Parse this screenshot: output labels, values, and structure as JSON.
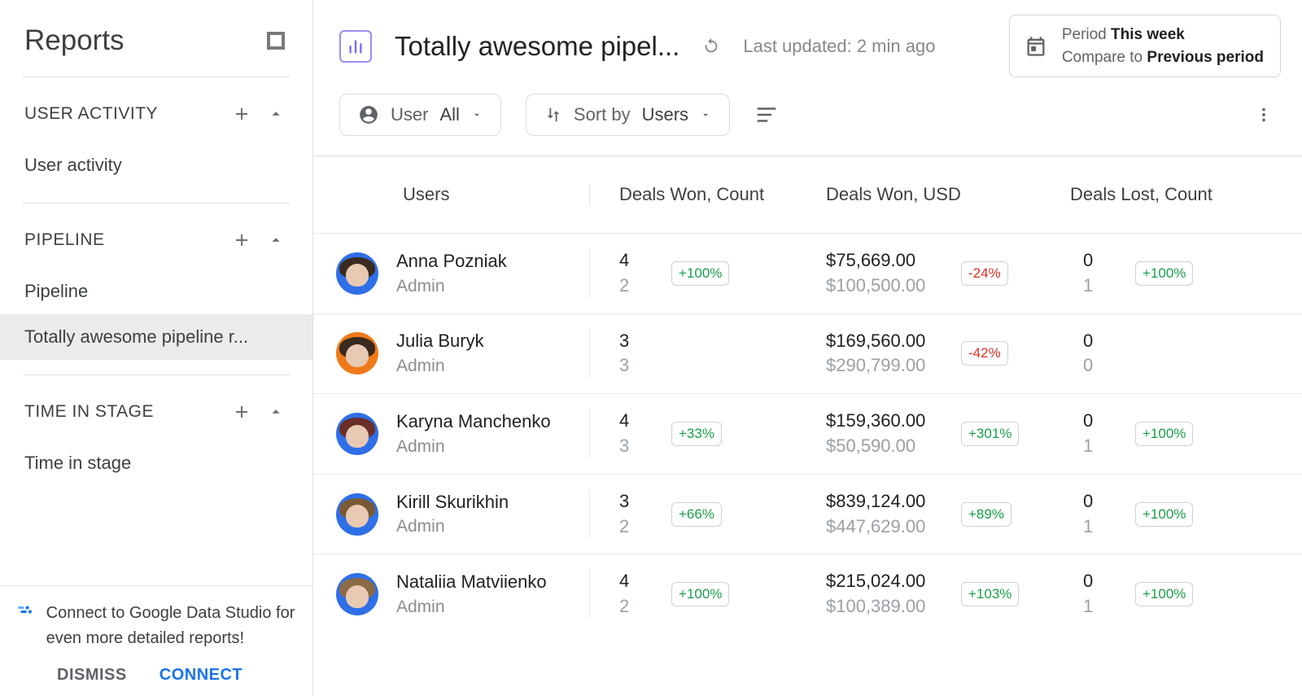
{
  "sidebar": {
    "title": "Reports",
    "sections": [
      {
        "title": "USER ACTIVITY",
        "items": [
          "User activity"
        ]
      },
      {
        "title": "PIPELINE",
        "items": [
          "Pipeline",
          "Totally awesome pipeline r..."
        ],
        "activeIndex": 1
      },
      {
        "title": "TIME IN STAGE",
        "items": [
          "Time in stage"
        ]
      }
    ],
    "promo": {
      "text": "Connect to Google Data Studio for even more detailed reports!",
      "dismiss": "DISMISS",
      "connect": "CONNECT"
    }
  },
  "header": {
    "report_title": "Totally awesome pipel...",
    "last_updated_prefix": "Last updated:",
    "last_updated_value": "2 min ago",
    "period_label": "Period",
    "period_value": "This week",
    "compare_label": "Compare to",
    "compare_value": "Previous period"
  },
  "filters": {
    "user_label": "User",
    "user_value": "All",
    "sort_label": "Sort by",
    "sort_value": "Users"
  },
  "columns": [
    "Users",
    "Deals Won, Count",
    "Deals Won, USD",
    "Deals Lost, Count"
  ],
  "rows": [
    {
      "name": "Anna Pozniak",
      "role": "Admin",
      "avatar_bg": "#2f6fe8",
      "hair": "#3a2a1f",
      "won_count": {
        "cur": "4",
        "prev": "2",
        "delta": "+100%",
        "dir": "pos"
      },
      "won_usd": {
        "cur": "$75,669.00",
        "prev": "$100,500.00",
        "delta": "-24%",
        "dir": "neg"
      },
      "lost_count": {
        "cur": "0",
        "prev": "1",
        "delta": "+100%",
        "dir": "pos"
      }
    },
    {
      "name": "Julia Buryk",
      "role": "Admin",
      "avatar_bg": "#f07a1a",
      "hair": "#3a2a1f",
      "won_count": {
        "cur": "3",
        "prev": "3",
        "delta": "",
        "dir": ""
      },
      "won_usd": {
        "cur": "$169,560.00",
        "prev": "$290,799.00",
        "delta": "-42%",
        "dir": "neg"
      },
      "lost_count": {
        "cur": "0",
        "prev": "0",
        "delta": "",
        "dir": ""
      }
    },
    {
      "name": "Karyna Manchenko",
      "role": "Admin",
      "avatar_bg": "#2f6fe8",
      "hair": "#6b2f2a",
      "won_count": {
        "cur": "4",
        "prev": "3",
        "delta": "+33%",
        "dir": "pos"
      },
      "won_usd": {
        "cur": "$159,360.00",
        "prev": "$50,590.00",
        "delta": "+301%",
        "dir": "pos"
      },
      "lost_count": {
        "cur": "0",
        "prev": "1",
        "delta": "+100%",
        "dir": "pos"
      }
    },
    {
      "name": "Kirill Skurikhin",
      "role": "Admin",
      "avatar_bg": "#2f6fe8",
      "hair": "#7a5a34",
      "won_count": {
        "cur": "3",
        "prev": "2",
        "delta": "+66%",
        "dir": "pos"
      },
      "won_usd": {
        "cur": "$839,124.00",
        "prev": "$447,629.00",
        "delta": "+89%",
        "dir": "pos"
      },
      "lost_count": {
        "cur": "0",
        "prev": "1",
        "delta": "+100%",
        "dir": "pos"
      }
    },
    {
      "name": "Nataliia Matviienko",
      "role": "Admin",
      "avatar_bg": "#2f6fe8",
      "hair": "#8a6b45",
      "won_count": {
        "cur": "4",
        "prev": "2",
        "delta": "+100%",
        "dir": "pos"
      },
      "won_usd": {
        "cur": "$215,024.00",
        "prev": "$100,389.00",
        "delta": "+103%",
        "dir": "pos"
      },
      "lost_count": {
        "cur": "0",
        "prev": "1",
        "delta": "+100%",
        "dir": "pos"
      }
    }
  ]
}
